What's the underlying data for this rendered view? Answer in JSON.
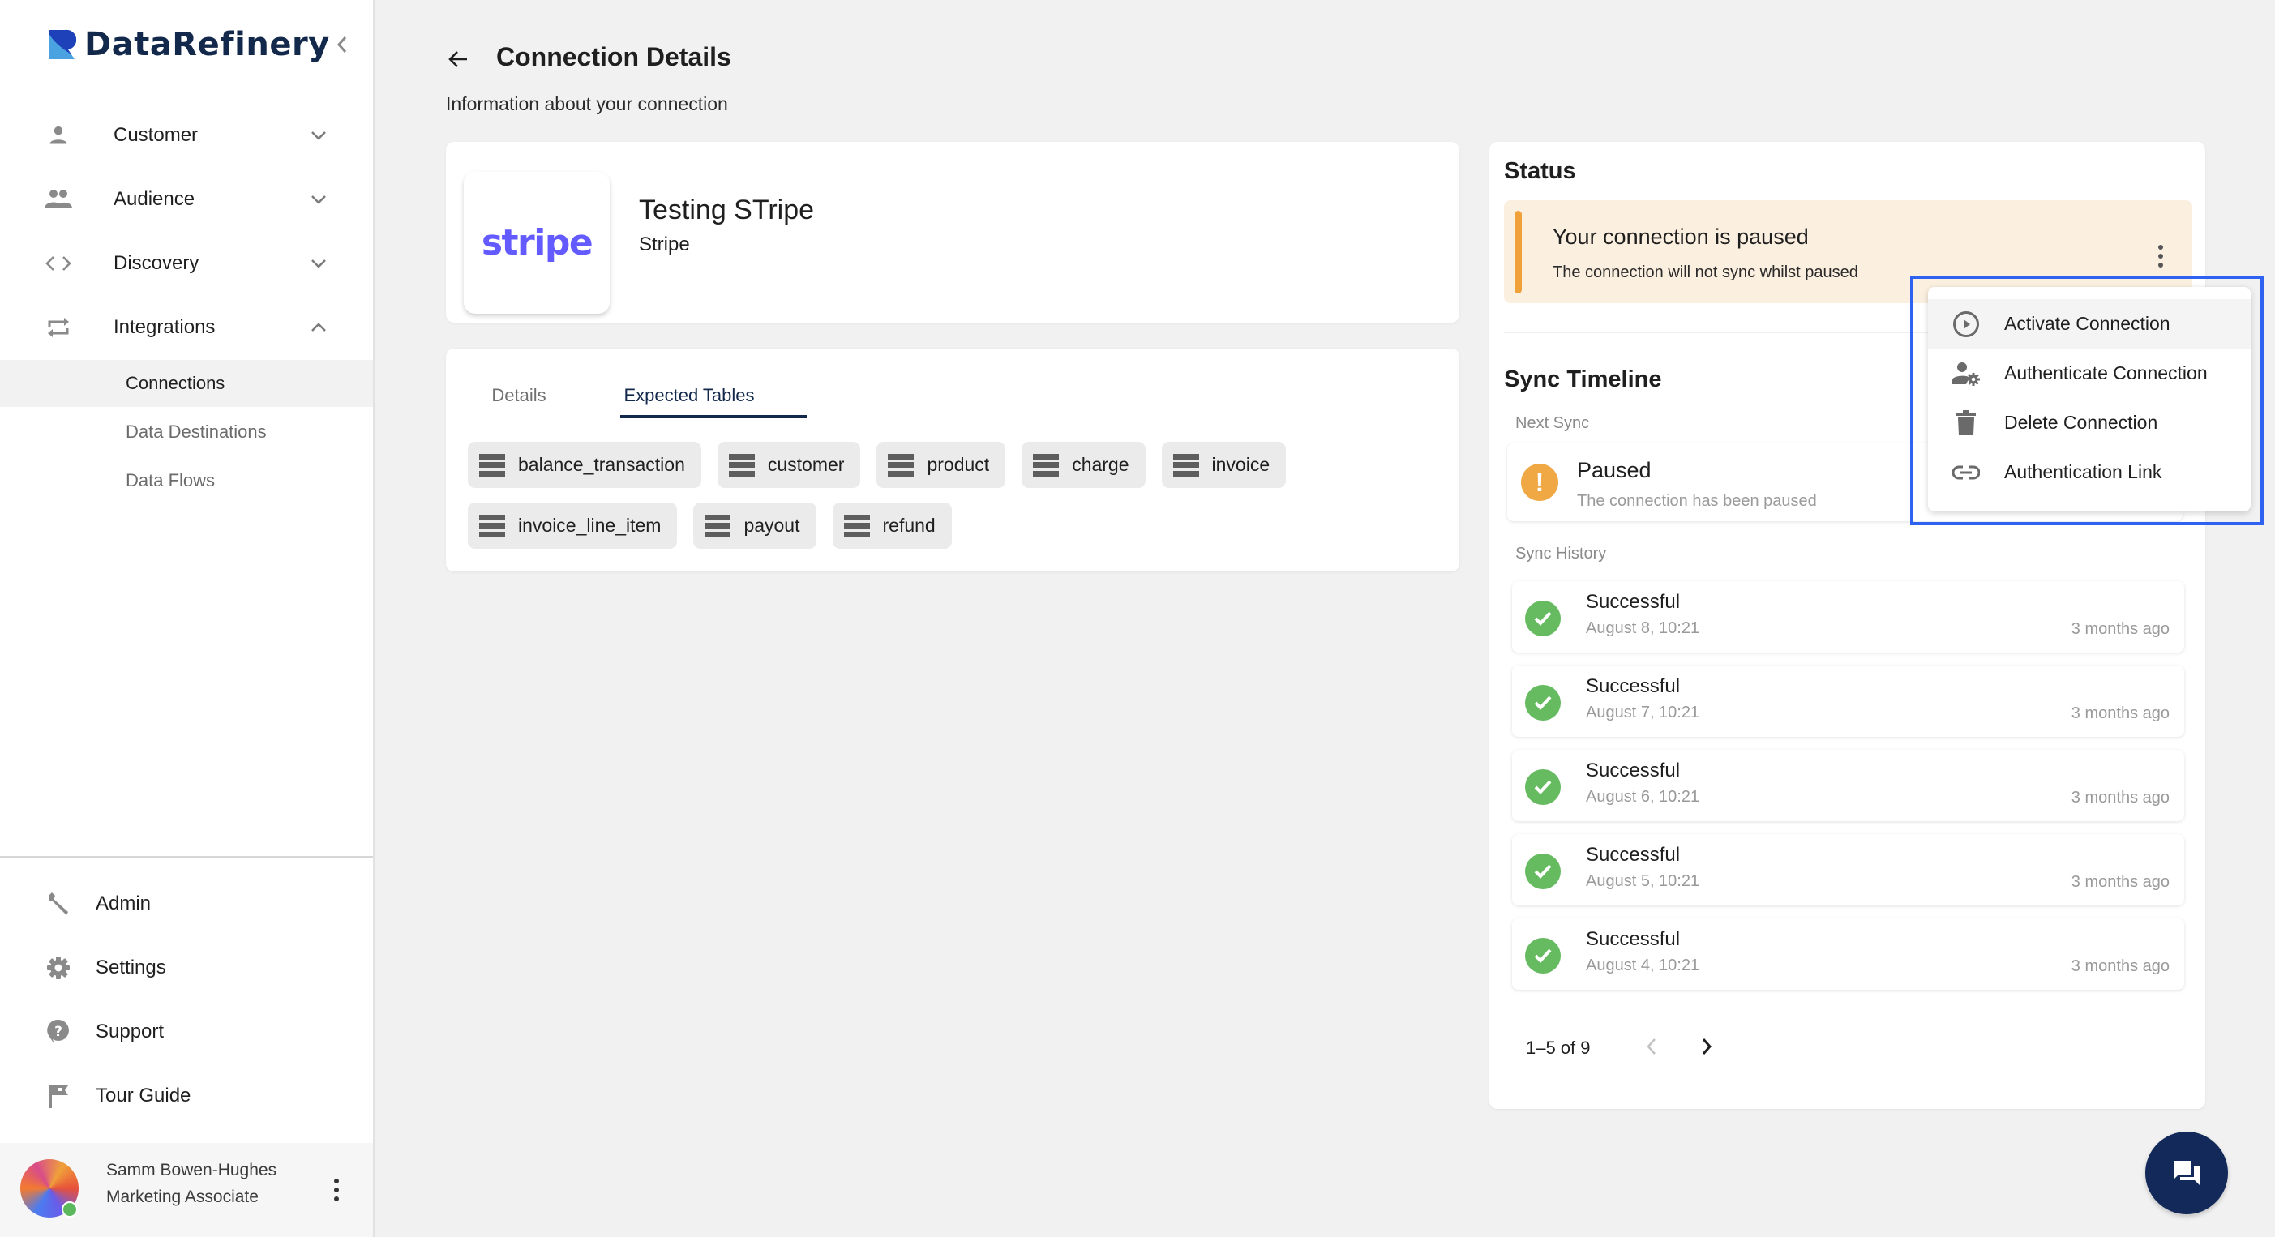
{
  "brand": {
    "name": "DataRefinery",
    "primary_color": "#13294b",
    "logo_colors": [
      "#1e40b8",
      "#4aa3e0"
    ]
  },
  "sidebar": {
    "collapse_icon": "chevron-left-icon",
    "nav": [
      {
        "label": "Customer",
        "icon": "person-icon",
        "expanded": false
      },
      {
        "label": "Audience",
        "icon": "people-icon",
        "expanded": false
      },
      {
        "label": "Discovery",
        "icon": "code-icon",
        "expanded": false
      },
      {
        "label": "Integrations",
        "icon": "repeat-icon",
        "expanded": true
      }
    ],
    "sub_items": [
      {
        "label": "Connections",
        "active": true
      },
      {
        "label": "Data Destinations",
        "active": false
      },
      {
        "label": "Data Flows",
        "active": false
      }
    ],
    "bottom": [
      {
        "label": "Admin",
        "icon": "wrench-icon"
      },
      {
        "label": "Settings",
        "icon": "gear-icon"
      },
      {
        "label": "Support",
        "icon": "help-icon"
      },
      {
        "label": "Tour Guide",
        "icon": "flag-icon"
      }
    ],
    "user": {
      "name": "Samm Bowen-Hughes",
      "role": "Marketing Associate",
      "status": "online"
    }
  },
  "header": {
    "title": "Connection Details",
    "subtitle": "Information about your connection"
  },
  "connection": {
    "name": "Testing STripe",
    "type": "Stripe",
    "logo_text": "stripe",
    "logo_color": "#635bff"
  },
  "tabs": {
    "items": [
      {
        "label": "Details",
        "active": false
      },
      {
        "label": "Expected Tables",
        "active": true
      }
    ]
  },
  "expected_tables": [
    "balance_transaction",
    "customer",
    "product",
    "charge",
    "invoice",
    "invoice_line_item",
    "payout",
    "refund"
  ],
  "status": {
    "title": "Status",
    "alert_title": "Your connection is paused",
    "alert_desc": "The connection will not sync whilst paused",
    "alert_color": "#f0a13a",
    "sync_timeline_title": "Sync Timeline",
    "next_sync_label": "Next Sync",
    "next_sync_status": "Paused",
    "next_sync_desc": "The connection has been paused",
    "history_label": "Sync History",
    "history": [
      {
        "status": "Successful",
        "date": "August 8, 10:21",
        "ago": "3 months ago"
      },
      {
        "status": "Successful",
        "date": "August 7, 10:21",
        "ago": "3 months ago"
      },
      {
        "status": "Successful",
        "date": "August 6, 10:21",
        "ago": "3 months ago"
      },
      {
        "status": "Successful",
        "date": "August 5, 10:21",
        "ago": "3 months ago"
      },
      {
        "status": "Successful",
        "date": "August 4, 10:21",
        "ago": "3 months ago"
      }
    ],
    "pagination": "1–5 of 9",
    "prev_disabled": true
  },
  "menu": {
    "items": [
      {
        "label": "Activate Connection",
        "icon": "play-circle-icon",
        "hover": true
      },
      {
        "label": "Authenticate Connection",
        "icon": "user-gear-icon",
        "hover": false
      },
      {
        "label": "Delete Connection",
        "icon": "trash-icon",
        "hover": false
      },
      {
        "label": "Authentication Link",
        "icon": "link-icon",
        "hover": false
      }
    ],
    "highlight_color": "#2f62f0"
  },
  "fab": {
    "icon": "chat-icon"
  }
}
